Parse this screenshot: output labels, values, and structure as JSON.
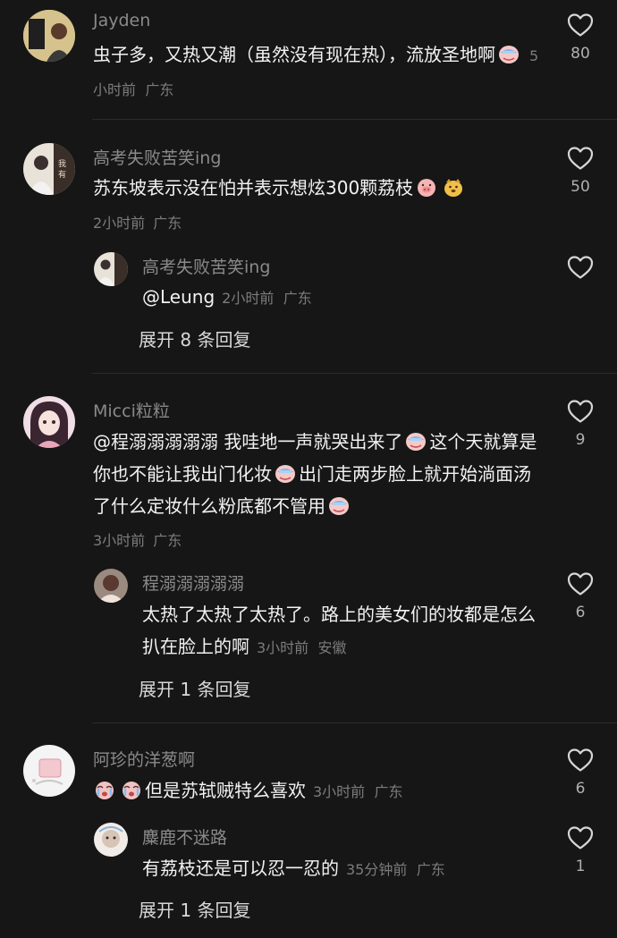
{
  "comments": [
    {
      "user": "Jayden",
      "text": "虫子多，又热又潮（虽然没有现在热），流放圣地啊",
      "emoji_after": [
        "hot-face-emoji"
      ],
      "time": "5小时前",
      "location": "广东",
      "likes": "80"
    },
    {
      "user": "高考失败苦笑ing",
      "text": "苏东坡表示没在怕并表示想炫300颗荔枝",
      "emoji_after": [
        "pig-face-emoji",
        "dog-face-emoji"
      ],
      "time": "2小时前",
      "location": "广东",
      "likes": "50",
      "reply": {
        "user": "高考失败苦笑ing",
        "text": "@Leung",
        "time": "2小时前",
        "location": "广东",
        "likes": ""
      },
      "expand_label": "展开 8 条回复"
    },
    {
      "user": "Micci粒粒",
      "mention": "@程溺溺溺溺溺",
      "text_part1": " 我哇地一声就哭出来了",
      "text_part2": "这个天就算是你也不能让我出门化妆",
      "text_part3": "出门走两步脸上就开始淌面汤了什么定妆什么粉底都不管用",
      "time": "3小时前",
      "location": "广东",
      "likes": "9",
      "reply": {
        "user": "程溺溺溺溺溺",
        "text": "太热了太热了太热了。路上的美女们的妆都是怎么扒在脸上的啊",
        "time": "3小时前",
        "location": "安徽",
        "likes": "6"
      },
      "expand_label": "展开 1 条回复"
    },
    {
      "user": "阿珍的洋葱啊",
      "text": "但是苏轼贼特么喜欢",
      "emoji_before": [
        "crying-face-emoji",
        "crying-face-emoji"
      ],
      "time": "3小时前",
      "location": "广东",
      "likes": "6",
      "reply": {
        "user": "麋鹿不迷路",
        "text": "有荔枝还是可以忍一忍的",
        "time": "35分钟前",
        "location": "广东",
        "likes": "1"
      },
      "expand_label": "展开 1 条回复"
    }
  ],
  "colors": {
    "background": "#161616",
    "username": "#8a8a8a",
    "meta": "#7c7c7c",
    "text": "#f2f2f2"
  }
}
